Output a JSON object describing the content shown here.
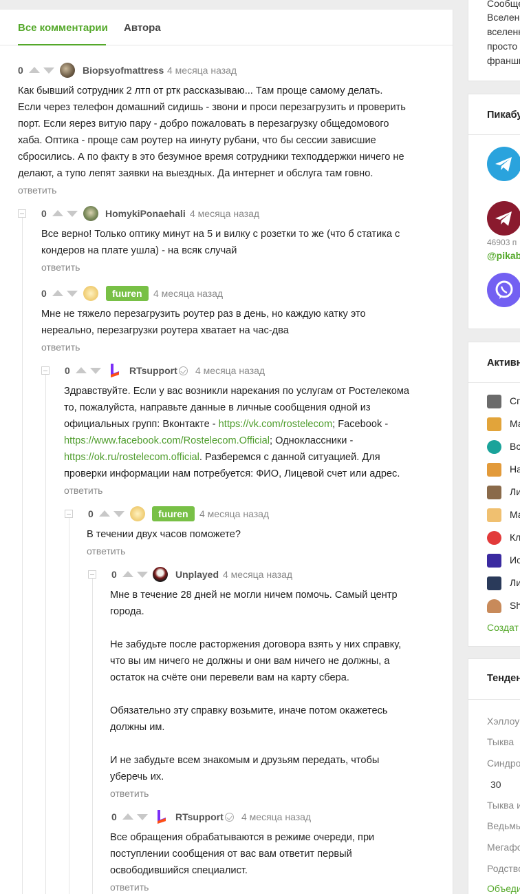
{
  "tabs": {
    "all": "Все комментарии",
    "author": "Автора"
  },
  "reply_label": "ответить",
  "comments": [
    {
      "rating": "0",
      "nick": "Biopsyofmattress",
      "time": "4 месяца назад",
      "lines": [
        "Как бывший сотрудник 2 лтп от ртк рассказываю... Там проще самому делать.",
        "Если через телефон домашний сидишь - звони и проси перезагрузить и проверить",
        "порт. Если яерез витую пару - добро пожаловать в перезагрузку общедомового",
        "хаба. Оптика - проще сам роутер на иинуту рубани, что бы сессии зависшие",
        "сбросились. А по факту в это безумное время сотрудники техподдержки ничего не",
        "делают, а тупо лепят заявки на выездных. Да интернет и обслуга там говно."
      ]
    },
    {
      "rating": "0",
      "nick": "HomykiPonaehali",
      "time": "4 месяца назад",
      "lines": [
        "Все верно! Только оптику минут на 5 и вилку с розетки то же (что б статика с",
        "кондеров на плате ушла) - на всяк случай"
      ]
    },
    {
      "rating": "0",
      "nick": "fuuren",
      "time": "4 месяца назад",
      "lines": [
        "Мне не тяжело перезагрузить роутер раз в день, но каждую катку это",
        "нереально, перезагрузки роутера хватает на час-два"
      ]
    },
    {
      "rating": "0",
      "nick": "RTsupport",
      "time": "4 месяца назад",
      "line1": "Здравствуйте. Если у вас возникли нарекания по услугам от Ростелекома",
      "line2": "то, пожалуйста, направьте данные в личные сообщения одной из",
      "line3_pre": "официальных групп: Вконтакте - ",
      "vk_link": "https://vk.com/rostelecom",
      "line3_post": "; Facebook -",
      "fb_link": "https://www.facebook.com/Rostelecom.Official",
      "line4_post": "; Одноклассники -",
      "ok_link": "https://ok.ru/rostelecom.official",
      "line5_post": ". Разберемся с данной ситуацией. Для",
      "line6": "проверки информации нам потребуется: ФИО, Лицевой счет или адрес."
    },
    {
      "rating": "0",
      "nick": "fuuren",
      "time": "4 месяца назад",
      "lines": [
        "В течении двух часов поможете?"
      ]
    },
    {
      "rating": "0",
      "nick": "Unplayed",
      "time": "4 месяца назад",
      "lines": [
        "Мне в течение 28 дней не могли ничем помочь. Самый центр",
        "города.",
        "",
        "Не забудьте после расторжения договора взять у них справку,",
        "что вы им ничего не должны и они вам ничего не должны, а",
        "остаток на счёте они перевели вам на карту сбера.",
        "",
        "Обязательно эту справку возьмите, иначе потом окажетесь",
        "должны им.",
        "",
        "И не забудьте всем знакомым и друзьям передать, чтобы",
        "уберечь их."
      ]
    },
    {
      "rating": "0",
      "nick": "RTsupport",
      "time": "4 месяца назад",
      "lines": [
        "Все обращения обрабатываются в режиме очереди, при",
        "поступлении сообщения от вас вам ответит первый",
        "освободившийся специалист."
      ]
    }
  ],
  "sidebar": {
    "top_lines": [
      "Сообщес",
      "Вселен",
      "вселенн",
      "просто",
      "франши"
    ],
    "pikabu_title": "Пикабу",
    "subscribers": "46903 п",
    "tg_handle": "@pikabu",
    "active_title": "Активн",
    "communities": [
      {
        "name": "Сп",
        "color": "#6b6b6b"
      },
      {
        "name": "Ма",
        "color": "#e2a43a"
      },
      {
        "name": "Вс",
        "color": "#1aa39a"
      },
      {
        "name": "На",
        "color": "#e29a3a"
      },
      {
        "name": "Ли",
        "color": "#8a6a4a"
      },
      {
        "name": "Ма",
        "color": "#f0c070"
      },
      {
        "name": "Кл",
        "color": "#e23a3a"
      },
      {
        "name": "Ис",
        "color": "#3a2aa0"
      },
      {
        "name": "Ли",
        "color": "#2a3a5a"
      },
      {
        "name": "Sh",
        "color": "#c88a5a"
      }
    ],
    "create_link": "Создат",
    "trends_title": "Тенден",
    "trends": [
      "Хэллоуи",
      "Тыква",
      "Синдро",
      "30",
      "Тыква и",
      "Ведьмы",
      "Мегафо",
      "Родство",
      "Объеди"
    ]
  }
}
